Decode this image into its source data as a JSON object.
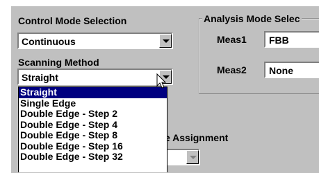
{
  "control_mode": {
    "label": "Control Mode Selection",
    "value": "Continuous"
  },
  "scanning_method": {
    "label": "Scanning Method",
    "value": "Straight",
    "options": [
      "Straight",
      "Single Edge",
      "Double Edge - Step 2",
      "Double Edge - Step 4",
      "Double Edge - Step 8",
      "Double Edge - Step 16",
      "Double Edge - Step 32"
    ],
    "selected_index": 0
  },
  "analysis_mode": {
    "title": "Analysis Mode Selec",
    "meas1_label": "Meas1",
    "meas1_value": "FBB",
    "meas2_label": "Meas2",
    "meas2_value": "None"
  },
  "assignment": {
    "label": "e Assignment"
  },
  "colors": {
    "panel": "#c0c0c0",
    "selection": "#000080"
  }
}
